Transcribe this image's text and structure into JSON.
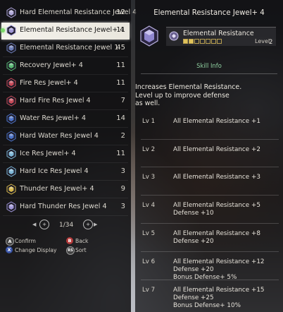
{
  "list": {
    "items": [
      {
        "name": "Hard Elemental Resistance Jewel 4",
        "qty": "12",
        "color": "#b0a8d8"
      },
      {
        "name": "Elemental Resistance Jewel+ 4",
        "qty": "11",
        "color": "#9f96d6",
        "selected": true
      },
      {
        "name": "Elemental Resistance Jewel 1",
        "qty": "45",
        "color": "#6d7fb8"
      },
      {
        "name": "Recovery Jewel+ 4",
        "qty": "11",
        "color": "#59b873"
      },
      {
        "name": "Fire Res Jewel+ 4",
        "qty": "11",
        "color": "#c94c5a"
      },
      {
        "name": "Hard Fire Res Jewel 4",
        "qty": "7",
        "color": "#c94c5a"
      },
      {
        "name": "Water Res Jewel+ 4",
        "qty": "14",
        "color": "#4d74c8"
      },
      {
        "name": "Hard Water Res Jewel 4",
        "qty": "2",
        "color": "#4d74c8"
      },
      {
        "name": "Ice Res Jewel+ 4",
        "qty": "11",
        "color": "#7fb8d8"
      },
      {
        "name": "Hard Ice Res Jewel 4",
        "qty": "3",
        "color": "#7fb8d8"
      },
      {
        "name": "Thunder Res Jewel+ 4",
        "qty": "9",
        "color": "#d8b94c"
      },
      {
        "name": "Hard Thunder Res Jewel 4",
        "qty": "3",
        "color": "#9f96d6"
      }
    ],
    "page": "1/34"
  },
  "controls": {
    "confirm": {
      "btn": "A",
      "label": "Confirm",
      "color": "#3a3a3a"
    },
    "back": {
      "btn": "B",
      "label": "Back",
      "color": "#b43a3a"
    },
    "change": {
      "btn": "X",
      "label": "Change Display",
      "color": "#3a55a8"
    },
    "sort": {
      "btn": "RS",
      "label": "Sort",
      "color": "#3a3a3a"
    }
  },
  "detail": {
    "title": "Elemental Resistance Jewel+ 4",
    "skill_name": "Elemental Resistance",
    "level_label": "Level",
    "level_value": "2",
    "level_filled": 2,
    "level_max": 7,
    "tab": "Skill Info",
    "description": [
      "Increases Elemental Resistance.",
      "Level up to improve defense",
      "as well."
    ],
    "levels": [
      {
        "lv": "Lv 1",
        "effects": [
          "All Elemental Resistance +1"
        ]
      },
      {
        "lv": "Lv 2",
        "effects": [
          "All Elemental Resistance +2"
        ]
      },
      {
        "lv": "Lv 3",
        "effects": [
          "All Elemental Resistance +3"
        ]
      },
      {
        "lv": "Lv 4",
        "effects": [
          "All Elemental Resistance +5",
          "Defense +10"
        ]
      },
      {
        "lv": "Lv 5",
        "effects": [
          "All Elemental Resistance +8",
          "Defense +20"
        ]
      },
      {
        "lv": "Lv 6",
        "effects": [
          "All Elemental Resistance +12",
          "Defense +20",
          "Bonus Defense+ 5%"
        ]
      },
      {
        "lv": "Lv 7",
        "effects": [
          "All Elemental Resistance +15",
          "Defense +25",
          "Bonus Defense+ 10%"
        ]
      }
    ]
  }
}
